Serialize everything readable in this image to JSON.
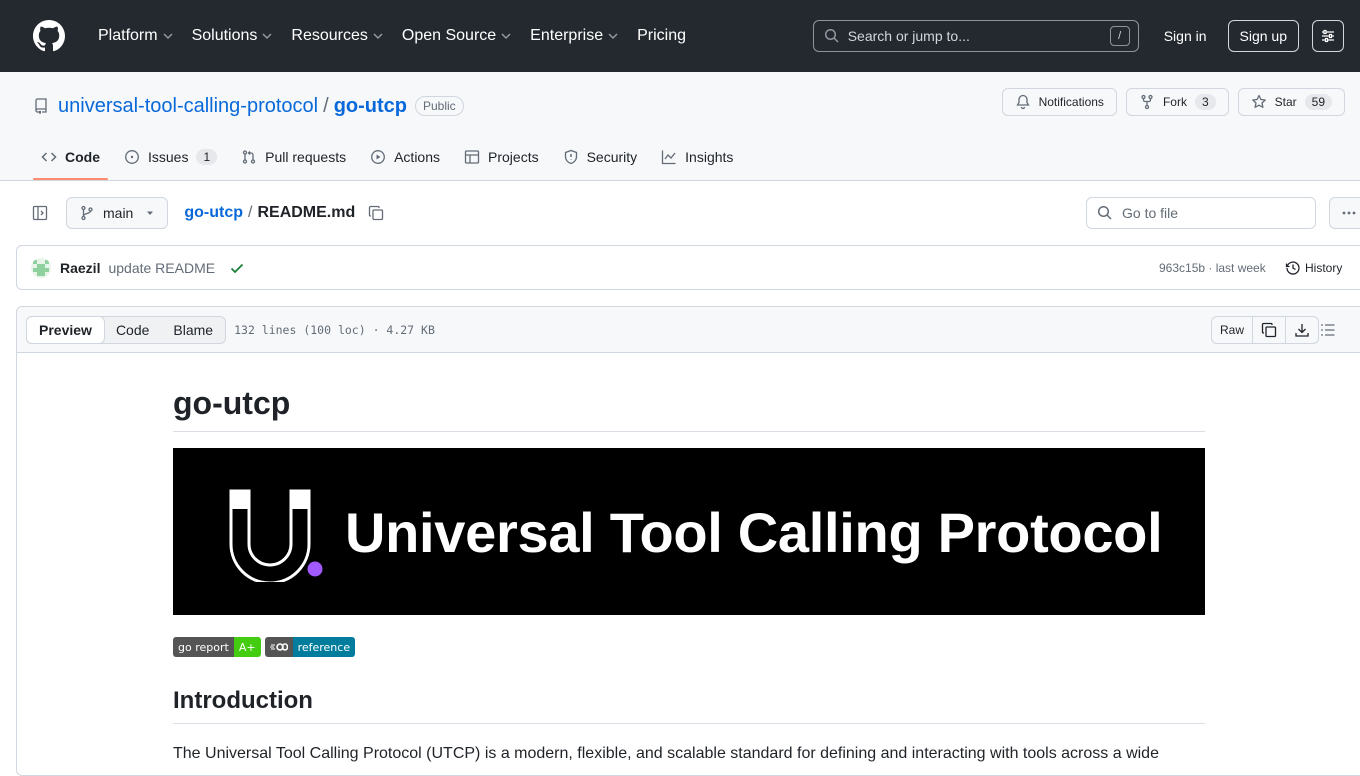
{
  "header": {
    "nav": [
      "Platform",
      "Solutions",
      "Resources",
      "Open Source",
      "Enterprise",
      "Pricing"
    ],
    "search_placeholder": "Search or jump to...",
    "search_kbd": "/",
    "sign_in": "Sign in",
    "sign_up": "Sign up"
  },
  "repo": {
    "owner": "universal-tool-calling-protocol",
    "name": "go-utcp",
    "visibility": "Public",
    "notifications_label": "Notifications",
    "fork_label": "Fork",
    "fork_count": "3",
    "star_label": "Star",
    "star_count": "59"
  },
  "tabs": [
    {
      "label": "Code",
      "icon": "code-icon",
      "active": true
    },
    {
      "label": "Issues",
      "icon": "issue-icon",
      "count": "1"
    },
    {
      "label": "Pull requests",
      "icon": "pull-request-icon"
    },
    {
      "label": "Actions",
      "icon": "play-icon"
    },
    {
      "label": "Projects",
      "icon": "table-icon"
    },
    {
      "label": "Security",
      "icon": "shield-icon"
    },
    {
      "label": "Insights",
      "icon": "graph-icon"
    }
  ],
  "filenav": {
    "branch": "main",
    "crumb_repo": "go-utcp",
    "crumb_sep": "/",
    "crumb_file": "README.md",
    "goto_placeholder": "Go to file"
  },
  "commit": {
    "author": "Raezil",
    "message": "update README",
    "meta": "963c15b · last week",
    "history": "History"
  },
  "file": {
    "views": [
      "Preview",
      "Code",
      "Blame"
    ],
    "stats": "132 lines (100 loc) · 4.27 KB",
    "raw": "Raw"
  },
  "readme": {
    "title": "go-utcp",
    "banner_text": "Universal Tool Calling Protocol",
    "badge1_left": "go report",
    "badge1_right": "A+",
    "badge2_right": "reference",
    "h2": "Introduction",
    "paragraph": "The Universal Tool Calling Protocol (UTCP) is a modern, flexible, and scalable standard for defining and interacting with tools across a wide"
  },
  "colors": {
    "header_bg": "#24292f",
    "link": "#0969da",
    "tab_underline": "#fd8c73",
    "check": "#1a7f37",
    "badge_green": "#4c1",
    "badge_blue": "#007d9c",
    "banner_dot": "#a259ff"
  }
}
